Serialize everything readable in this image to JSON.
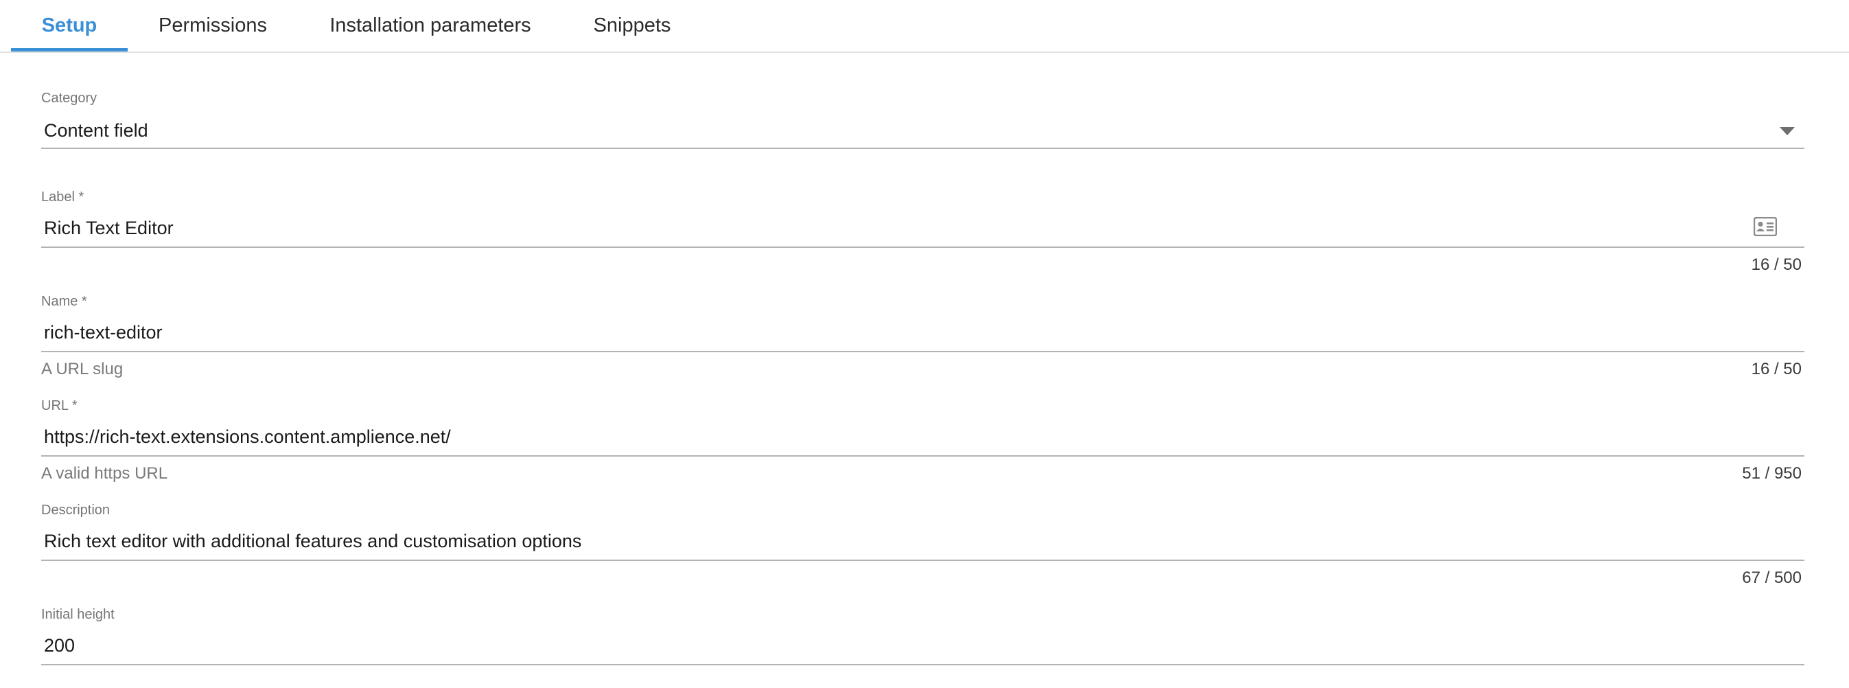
{
  "tabs": [
    {
      "label": "Setup",
      "active": true
    },
    {
      "label": "Permissions",
      "active": false
    },
    {
      "label": "Installation parameters",
      "active": false
    },
    {
      "label": "Snippets",
      "active": false
    }
  ],
  "colors": {
    "accent": "#3a8fd6",
    "divider": "#b3b3b3",
    "label": "#757575"
  },
  "form": {
    "category": {
      "label": "Category",
      "value": "Content field",
      "icon": "chevron-down-icon"
    },
    "label": {
      "label": "Label *",
      "value": "Rich Text Editor",
      "counter": "16 / 50",
      "icon": "contact-card-icon"
    },
    "name": {
      "label": "Name *",
      "value": "rich-text-editor",
      "helper": "A URL slug",
      "counter": "16 / 50"
    },
    "url": {
      "label": "URL *",
      "value": "https://rich-text.extensions.content.amplience.net/",
      "helper": "A valid https URL",
      "counter": "51 / 950"
    },
    "description": {
      "label": "Description",
      "value": "Rich text editor with additional features and customisation options",
      "counter": "67 / 500"
    },
    "initial_height": {
      "label": "Initial height",
      "value": "200"
    }
  }
}
